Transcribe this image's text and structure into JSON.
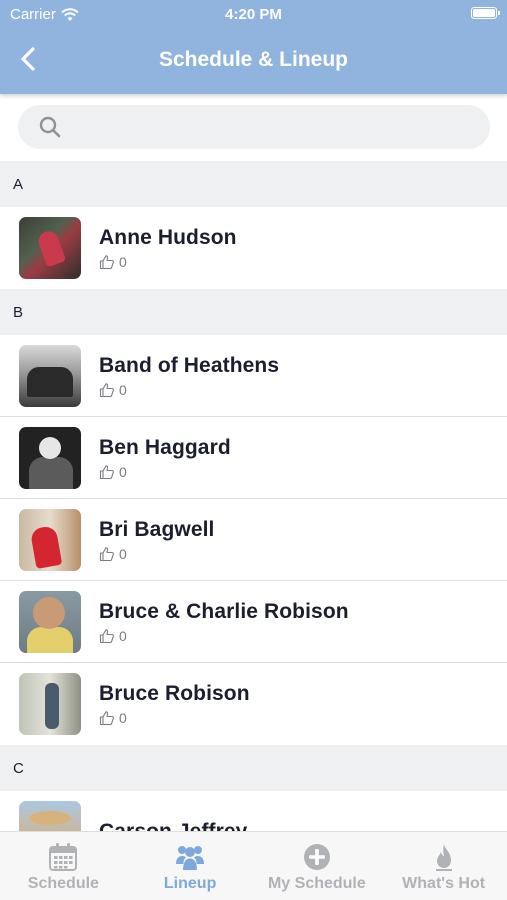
{
  "status_bar": {
    "carrier": "Carrier",
    "time": "4:20 PM"
  },
  "nav": {
    "title": "Schedule & Lineup"
  },
  "search": {
    "placeholder": ""
  },
  "sections": [
    {
      "letter": "A",
      "artists": [
        {
          "name": "Anne Hudson",
          "likes": "0"
        }
      ]
    },
    {
      "letter": "B",
      "artists": [
        {
          "name": "Band of Heathens",
          "likes": "0"
        },
        {
          "name": "Ben Haggard",
          "likes": "0"
        },
        {
          "name": "Bri Bagwell",
          "likes": "0"
        },
        {
          "name": "Bruce & Charlie Robison",
          "likes": "0"
        },
        {
          "name": "Bruce Robison",
          "likes": "0"
        }
      ]
    },
    {
      "letter": "C",
      "artists": [
        {
          "name": "Carson Jeffrey",
          "likes": ""
        }
      ]
    }
  ],
  "tabs": [
    {
      "label": "Schedule",
      "icon": "calendar-icon",
      "active": false
    },
    {
      "label": "Lineup",
      "icon": "people-icon",
      "active": true
    },
    {
      "label": "My Schedule",
      "icon": "plus-circle-icon",
      "active": false
    },
    {
      "label": "What's Hot",
      "icon": "flame-icon",
      "active": false
    }
  ],
  "colors": {
    "header": "#91b4de",
    "active_tab": "#7fa9dc",
    "inactive_tab": "#b0b2b6"
  }
}
